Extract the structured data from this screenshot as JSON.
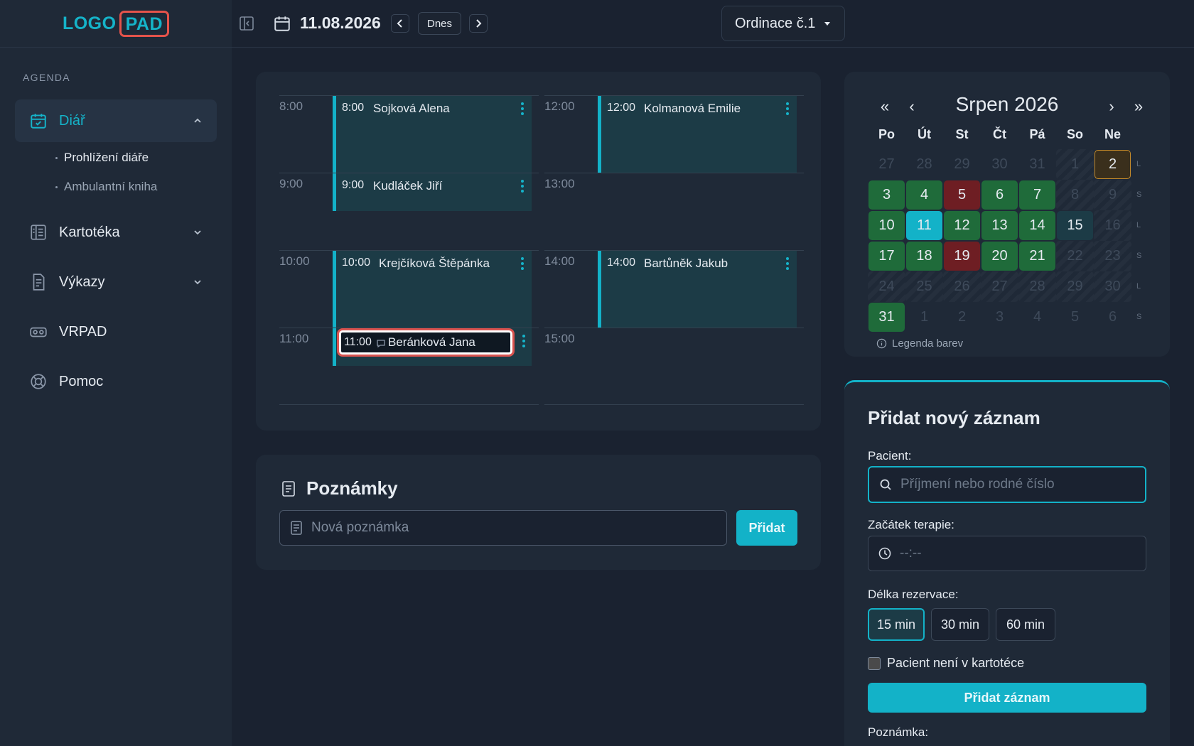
{
  "logo": {
    "text": "LOGO",
    "badge": "PAD"
  },
  "sidebar": {
    "section": "AGENDA",
    "items": [
      {
        "label": "Diář",
        "icon": "calendar-check-icon"
      },
      {
        "label": "Kartotéka",
        "icon": "card-index-icon"
      },
      {
        "label": "Výkazy",
        "icon": "report-icon"
      },
      {
        "label": "VRPAD",
        "icon": "vr-headset-icon"
      },
      {
        "label": "Pomoc",
        "icon": "lifebuoy-icon"
      }
    ],
    "subitems": [
      "Prohlížení diáře",
      "Ambulantní kniha"
    ]
  },
  "topbar": {
    "date": "11.08.2026",
    "today_label": "Dnes",
    "office": "Ordinace č.1"
  },
  "schedule": {
    "left": [
      {
        "time": "8:00",
        "appt_time": "8:00",
        "name": "Sojková Alena"
      },
      {
        "time": "9:00",
        "appt_time": "9:00",
        "name": "Kudláček Jiří"
      },
      {
        "time": "10:00",
        "appt_time": "10:00",
        "name": "Krejčíková Štěpánka"
      },
      {
        "time": "11:00",
        "appt_time": "11:00",
        "name": "Beránková Jana"
      }
    ],
    "right": [
      {
        "time": "12:00",
        "appt_time": "12:00",
        "name": "Kolmanová Emilie"
      },
      {
        "time": "13:00"
      },
      {
        "time": "14:00",
        "appt_time": "14:00",
        "name": "Bartůněk Jakub"
      },
      {
        "time": "15:00"
      }
    ]
  },
  "notes": {
    "title": "Poznámky",
    "placeholder": "Nová poznámka",
    "add_label": "Přidat"
  },
  "calendar": {
    "title": "Srpen 2026",
    "nav": {
      "first": "«",
      "prev": "‹",
      "next": "›",
      "last": "»"
    },
    "dows": [
      "Po",
      "Út",
      "St",
      "Čt",
      "Pá",
      "So",
      "Ne"
    ],
    "side_letters": [
      "L",
      "S",
      "L",
      "S",
      "L",
      "S"
    ],
    "legend": "Legenda barev",
    "colors": {
      "green": "#1f6b3a",
      "red": "#6e1e23",
      "today": "#13b2c8",
      "marked": "#c58b2a"
    },
    "weeks": [
      [
        {
          "d": "27",
          "s": "dim"
        },
        {
          "d": "28",
          "s": "dim"
        },
        {
          "d": "29",
          "s": "dim"
        },
        {
          "d": "30",
          "s": "dim"
        },
        {
          "d": "31",
          "s": "dim"
        },
        {
          "d": "1",
          "s": "hatch"
        },
        {
          "d": "2",
          "s": "mark"
        }
      ],
      [
        {
          "d": "3",
          "s": "green"
        },
        {
          "d": "4",
          "s": "green"
        },
        {
          "d": "5",
          "s": "red"
        },
        {
          "d": "6",
          "s": "green"
        },
        {
          "d": "7",
          "s": "green"
        },
        {
          "d": "8",
          "s": "hatch"
        },
        {
          "d": "9",
          "s": "hatch"
        }
      ],
      [
        {
          "d": "10",
          "s": "green"
        },
        {
          "d": "11",
          "s": "today"
        },
        {
          "d": "12",
          "s": "green"
        },
        {
          "d": "13",
          "s": "green"
        },
        {
          "d": "14",
          "s": "green"
        },
        {
          "d": "15",
          "s": "teal"
        },
        {
          "d": "16",
          "s": "hatch"
        }
      ],
      [
        {
          "d": "17",
          "s": "green"
        },
        {
          "d": "18",
          "s": "green"
        },
        {
          "d": "19",
          "s": "red"
        },
        {
          "d": "20",
          "s": "green"
        },
        {
          "d": "21",
          "s": "green"
        },
        {
          "d": "22",
          "s": "hatch"
        },
        {
          "d": "23",
          "s": "hatch"
        }
      ],
      [
        {
          "d": "24",
          "s": "hatch"
        },
        {
          "d": "25",
          "s": "hatch"
        },
        {
          "d": "26",
          "s": "hatch"
        },
        {
          "d": "27",
          "s": "hatch"
        },
        {
          "d": "28",
          "s": "hatch"
        },
        {
          "d": "29",
          "s": "hatch"
        },
        {
          "d": "30",
          "s": "hatch"
        }
      ],
      [
        {
          "d": "31",
          "s": "green"
        },
        {
          "d": "1",
          "s": "dim"
        },
        {
          "d": "2",
          "s": "dim"
        },
        {
          "d": "3",
          "s": "dim"
        },
        {
          "d": "4",
          "s": "dim"
        },
        {
          "d": "5",
          "s": "dim"
        },
        {
          "d": "6",
          "s": "dim"
        }
      ]
    ]
  },
  "form": {
    "title": "Přidat nový záznam",
    "patient_label": "Pacient:",
    "patient_placeholder": "Příjmení nebo rodné číslo",
    "start_label": "Začátek terapie:",
    "start_placeholder": "--:--",
    "duration_label": "Délka rezervace:",
    "durations": [
      "15 min",
      "30 min",
      "60 min"
    ],
    "checkbox_label": "Pacient není v kartotéce",
    "submit_label": "Přidat záznam",
    "note_label": "Poznámka:"
  }
}
